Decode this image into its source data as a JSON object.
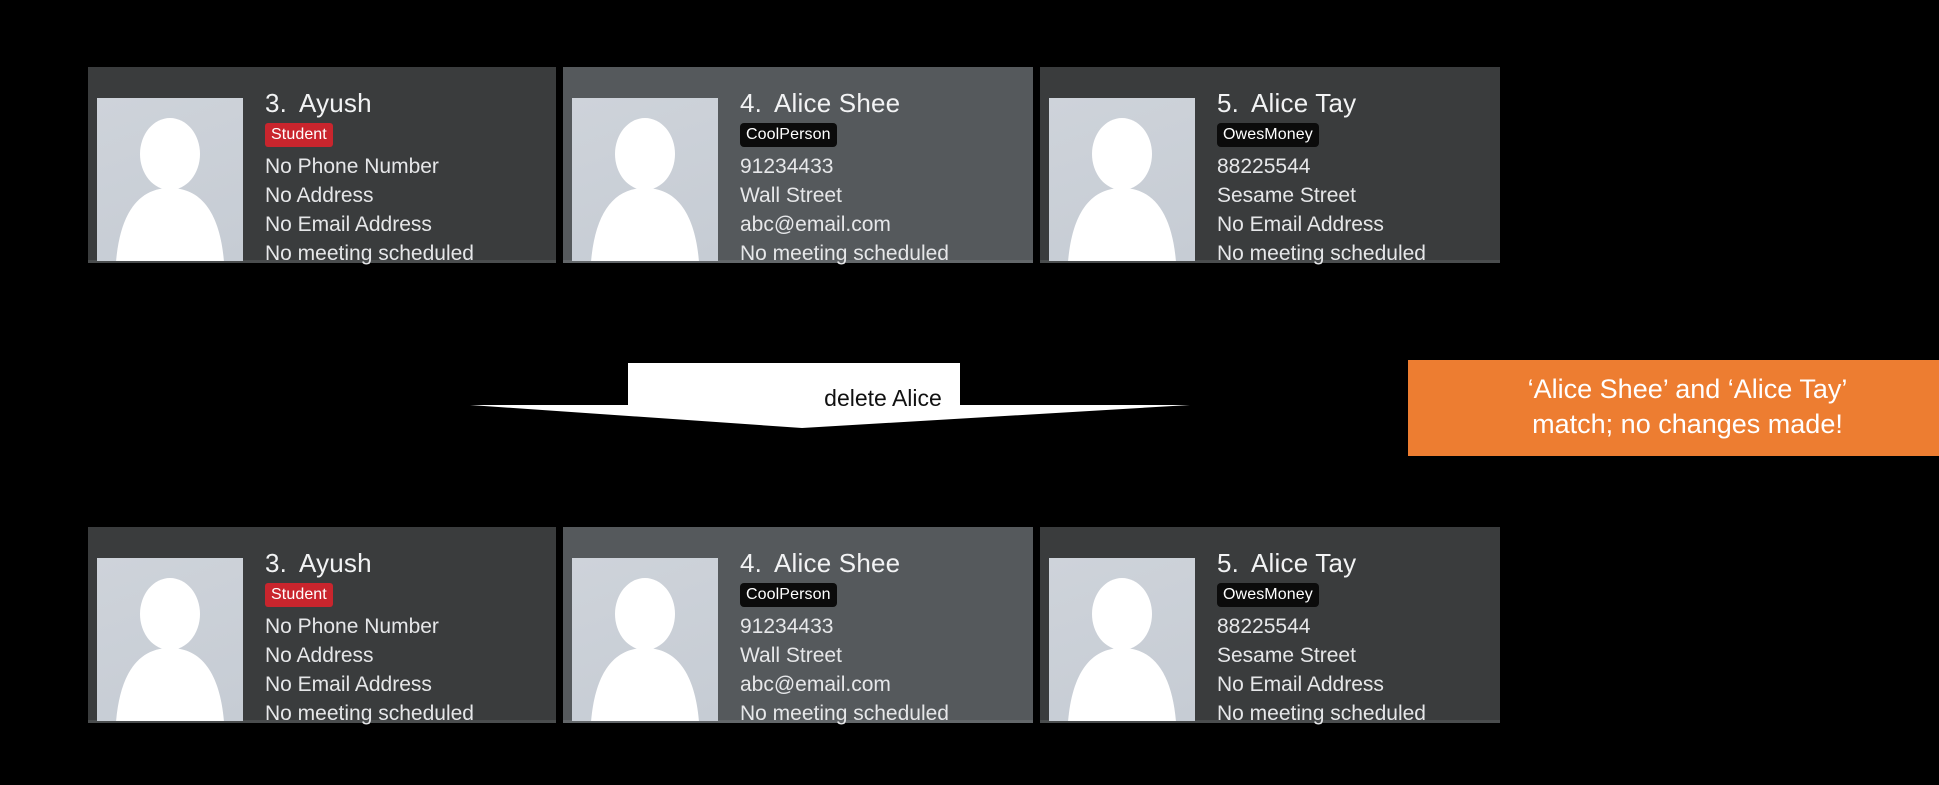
{
  "colors": {
    "background": "#000000",
    "card": "#3a3c3d",
    "card_highlight": "#55595c",
    "tag_student": "#c9252d",
    "tag_dark": "#0b0b0b",
    "callout": "#ed7d31",
    "arrow": "#ffffff",
    "avatar": "#ced3da"
  },
  "rows": [
    {
      "id": "before",
      "cards": [
        {
          "index": "3.",
          "name": "Ayush",
          "tag": "Student",
          "tag_style": "red",
          "phone": "No Phone Number",
          "address": "No Address",
          "email": "No Email Address",
          "meeting": "No meeting scheduled",
          "highlight": false
        },
        {
          "index": "4.",
          "name": "Alice Shee",
          "tag": "CoolPerson",
          "tag_style": "dark",
          "phone": "91234433",
          "address": "Wall Street",
          "email": "abc@email.com",
          "meeting": "No meeting scheduled",
          "highlight": true
        },
        {
          "index": "5.",
          "name": "Alice Tay",
          "tag": "OwesMoney",
          "tag_style": "dark",
          "phone": "88225544",
          "address": "Sesame Street",
          "email": "No Email Address",
          "meeting": "No meeting scheduled",
          "highlight": false
        }
      ]
    },
    {
      "id": "after",
      "cards": [
        {
          "index": "3.",
          "name": "Ayush",
          "tag": "Student",
          "tag_style": "red",
          "phone": "No Phone Number",
          "address": "No Address",
          "email": "No Email Address",
          "meeting": "No meeting scheduled",
          "highlight": false
        },
        {
          "index": "4.",
          "name": "Alice Shee",
          "tag": "CoolPerson",
          "tag_style": "dark",
          "phone": "91234433",
          "address": "Wall Street",
          "email": "abc@email.com",
          "meeting": "No meeting scheduled",
          "highlight": true
        },
        {
          "index": "5.",
          "name": "Alice Tay",
          "tag": "OwesMoney",
          "tag_style": "dark",
          "phone": "88225544",
          "address": "Sesame Street",
          "email": "No Email Address",
          "meeting": "No meeting scheduled",
          "highlight": false
        }
      ]
    }
  ],
  "annotation": {
    "arrow_label": "delete Alice",
    "arrow_icon": "down-arrow-icon"
  },
  "callout": {
    "line1": "‘Alice Shee’ and ‘Alice Tay’",
    "line2": "match; no changes made!"
  }
}
